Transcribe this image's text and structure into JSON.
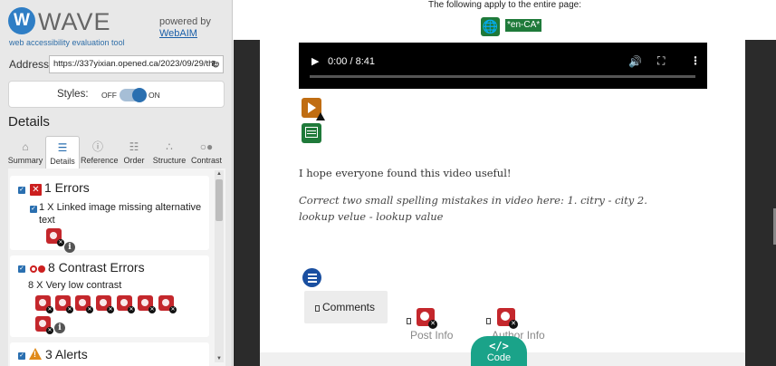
{
  "sidebar": {
    "logo_letter": "W",
    "logo_name": "WAVE",
    "tagline": "web accessibility evaluation tool",
    "powered_by": "powered by",
    "powered_link": "WebAIM",
    "address_label": "Address:",
    "address_value": "https://337yixian.opened.ca/2023/09/29/the",
    "styles_label": "Styles:",
    "styles_off": "OFF",
    "styles_on": "ON",
    "details_heading": "Details",
    "tabs": [
      {
        "label": "Summary",
        "icon": "home-icon"
      },
      {
        "label": "Details",
        "icon": "list-icon"
      },
      {
        "label": "Reference",
        "icon": "info-icon"
      },
      {
        "label": "Order",
        "icon": "order-icon"
      },
      {
        "label": "Structure",
        "icon": "structure-icon"
      },
      {
        "label": "Contrast",
        "icon": "contrast-icon"
      }
    ],
    "errors": {
      "title": "1 Errors",
      "item": "1 X Linked image missing alternative text"
    },
    "contrast": {
      "title": "8 Contrast Errors",
      "item": "8 X Very low contrast"
    },
    "alerts": {
      "title": "3 Alerts"
    }
  },
  "main": {
    "banner_text": "The following apply to the entire page:",
    "lang_tag": "*en-CA*",
    "video_time": "0:00 / 8:41",
    "video_progress": 0,
    "paragraph1": "I hope everyone found this video useful!",
    "paragraph2_line1": "Correct two small spelling mistakes in video here: 1. citry - city 2.",
    "paragraph2_line2": "lookup velue - lookup value",
    "comments_label": "Comments",
    "post_info": "Post Info",
    "author_info": "Author Info",
    "code_label": "Code",
    "code_icon_text": "</>"
  },
  "colors": {
    "wave_blue": "#2f7ec5",
    "error_red": "#cc1f1f",
    "green_tag": "#1f7a3a",
    "code_teal": "#1aa389",
    "alert_orange": "#e08a1a"
  }
}
